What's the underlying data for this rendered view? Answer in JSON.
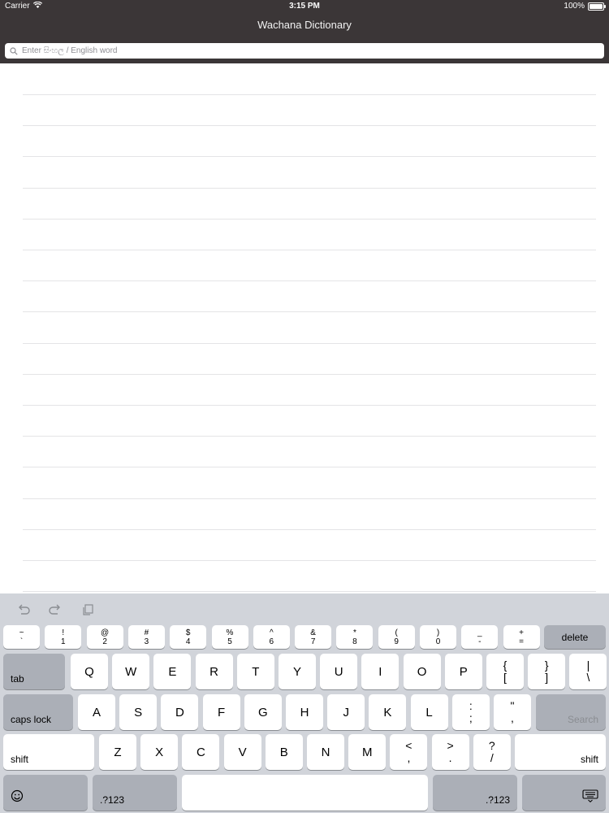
{
  "status_bar": {
    "carrier": "Carrier",
    "time": "3:15 PM",
    "battery": "100%"
  },
  "app": {
    "title": "Wachana Dictionary",
    "search": {
      "placeholder": "Enter සිංහල / English word",
      "value": ""
    }
  },
  "list": {
    "row_count": 17
  },
  "keyboard": {
    "shortcuts": [
      "undo-icon",
      "redo-icon",
      "paste-icon"
    ],
    "number_row": [
      {
        "top": "~",
        "bottom": "`"
      },
      {
        "top": "!",
        "bottom": "1"
      },
      {
        "top": "@",
        "bottom": "2"
      },
      {
        "top": "#",
        "bottom": "3"
      },
      {
        "top": "$",
        "bottom": "4"
      },
      {
        "top": "%",
        "bottom": "5"
      },
      {
        "top": "^",
        "bottom": "6"
      },
      {
        "top": "&",
        "bottom": "7"
      },
      {
        "top": "*",
        "bottom": "8"
      },
      {
        "top": "(",
        "bottom": "9"
      },
      {
        "top": ")",
        "bottom": "0"
      },
      {
        "top": "_",
        "bottom": "-"
      },
      {
        "top": "+",
        "bottom": "="
      }
    ],
    "delete_label": "delete",
    "tab_label": "tab",
    "row_q": [
      "Q",
      "W",
      "E",
      "R",
      "T",
      "Y",
      "U",
      "I",
      "O",
      "P"
    ],
    "row_q_symbols": [
      {
        "top": "{",
        "bottom": "["
      },
      {
        "top": "}",
        "bottom": "]"
      },
      {
        "top": "|",
        "bottom": "\\"
      }
    ],
    "caps_label": "caps lock",
    "row_a": [
      "A",
      "S",
      "D",
      "F",
      "G",
      "H",
      "J",
      "K",
      "L"
    ],
    "row_a_symbols": [
      {
        "top": ":",
        "bottom": ";"
      },
      {
        "top": "\"",
        "bottom": ","
      }
    ],
    "search_label": "Search",
    "shift_label": "shift",
    "row_z": [
      "Z",
      "X",
      "C",
      "V",
      "B",
      "N",
      "M"
    ],
    "row_z_symbols": [
      {
        "top": "<",
        "bottom": ","
      },
      {
        "top": ">",
        "bottom": "."
      },
      {
        "top": "?",
        "bottom": "/"
      }
    ],
    "numbers_label": ".?123"
  },
  "colors": {
    "header_bg": "#3b3637",
    "keyboard_bg": "#d1d4da",
    "key_bg": "#ffffff",
    "key_dark_bg": "#abafb7"
  }
}
